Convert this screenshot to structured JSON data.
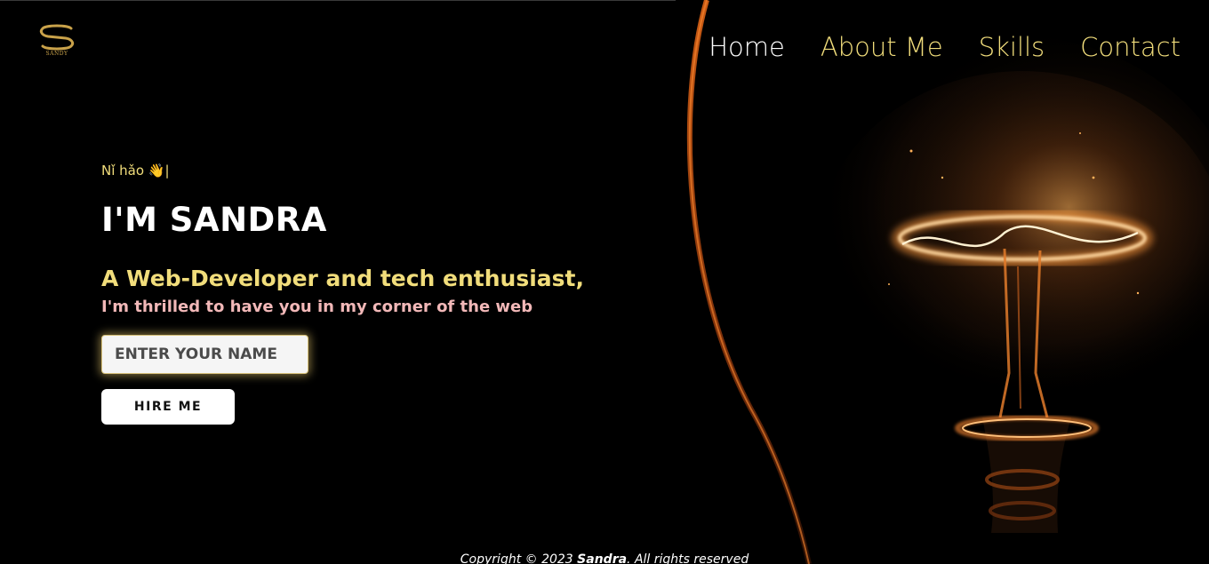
{
  "logo": {
    "text": "SANDY",
    "icon": "s-monogram-logo",
    "color": "#c9a24a"
  },
  "nav": {
    "items": [
      {
        "label": "Home",
        "active": true
      },
      {
        "label": "About Me",
        "active": false
      },
      {
        "label": "Skills",
        "active": false
      },
      {
        "label": "Contact",
        "active": false
      }
    ]
  },
  "hero": {
    "greeting": "Nǐ hǎo",
    "greeting_emoji": "👋",
    "greeting_cursor": "|",
    "title": "I'M SANDRA",
    "subtitle": "A Web-Developer and tech enthusiast,",
    "tagline": "I'm thrilled to have you in my corner of the web",
    "name_input": {
      "placeholder": "ENTER YOUR NAME",
      "value": ""
    },
    "hire_button": "HIRE ME"
  },
  "footer": {
    "prefix": "Copyright © 2023 ",
    "name": "Sandra",
    "suffix": ". All rights reserved"
  },
  "colors": {
    "background": "#000000",
    "accent_gold": "#f1dd7b",
    "tagline_pink": "#f2b8b8",
    "nav_active": "#ffffff",
    "bulb_glow": "#ff9a3c"
  },
  "background_image": "glowing-light-bulb"
}
